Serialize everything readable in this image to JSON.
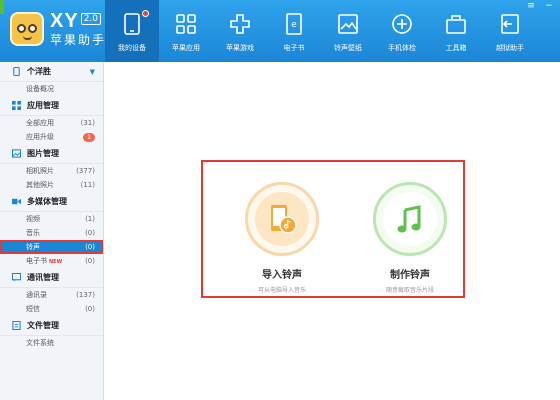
{
  "app": {
    "brand": "XY",
    "version": "2.0",
    "name": "苹果助手"
  },
  "nav": [
    {
      "label": "我的设备",
      "icon": "device-icon",
      "active": true,
      "has_dot": true
    },
    {
      "label": "苹果应用",
      "icon": "apps-icon"
    },
    {
      "label": "苹果游戏",
      "icon": "games-icon"
    },
    {
      "label": "电子书",
      "icon": "ebook-icon"
    },
    {
      "label": "铃声壁纸",
      "icon": "ringtone-wallpaper-icon"
    },
    {
      "label": "手机体检",
      "icon": "checkup-icon"
    },
    {
      "label": "工具箱",
      "icon": "toolbox-icon"
    },
    {
      "label": "越狱助手",
      "icon": "jailbreak-icon"
    }
  ],
  "window_controls": {
    "menu": "≡",
    "minimize": "−"
  },
  "sidebar": {
    "device": {
      "title": "个洋胜",
      "overview": "设备概况"
    },
    "apps": {
      "title": "应用管理",
      "all": "全部应用",
      "all_count": "(31)",
      "upgrade": "应用升级",
      "upgrade_badge": "1"
    },
    "photos": {
      "title": "图片管理",
      "camera": "相机照片",
      "camera_count": "(377)",
      "other": "其他照片",
      "other_count": "(11)"
    },
    "media": {
      "title": "多媒体管理",
      "video": "视频",
      "video_count": "(1)",
      "music": "音乐",
      "music_count": "(0)",
      "ringtone": "铃声",
      "ringtone_count": "(0)",
      "ebook": "电子书",
      "ebook_new": "NEW",
      "ebook_count": "(0)"
    },
    "comm": {
      "title": "通讯管理",
      "contacts": "通讯录",
      "contacts_count": "(137)",
      "sms": "短信",
      "sms_count": "(0)"
    },
    "files": {
      "title": "文件管理",
      "filesystem": "文件系统"
    }
  },
  "main": {
    "import": {
      "title": "导入铃声",
      "subtitle": "可从电脑导入音乐"
    },
    "make": {
      "title": "制作铃声",
      "subtitle": "随意截取音乐片段"
    }
  },
  "colors": {
    "accent": "#1b86d6",
    "highlight": "#e53935",
    "orange": "#f4a836",
    "green": "#5cc24a"
  }
}
